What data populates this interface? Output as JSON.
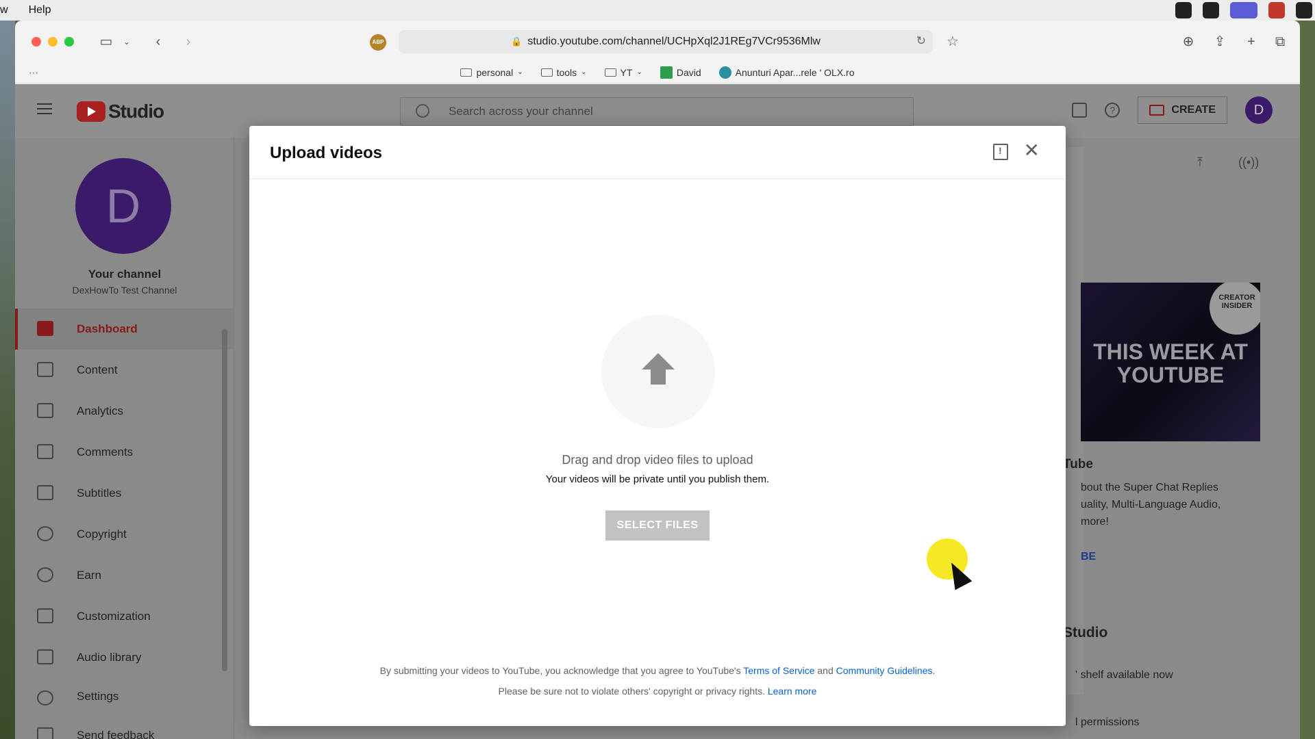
{
  "menubar": {
    "items": [
      "w",
      "Help"
    ]
  },
  "browser": {
    "url": "studio.youtube.com/channel/UCHpXql2J1REg7VCr9536Mlw",
    "abp_label": "ABP",
    "bookmarks": [
      {
        "label": "personal",
        "type": "folder"
      },
      {
        "label": "tools",
        "type": "folder"
      },
      {
        "label": "YT",
        "type": "folder"
      },
      {
        "label": "David",
        "type": "sheet"
      },
      {
        "label": "Anunturi Apar...rele ' OLX.ro",
        "type": "olx"
      }
    ]
  },
  "studio": {
    "logo_text": "Studio",
    "search_placeholder": "Search across your channel",
    "create_label": "CREATE",
    "avatar_letter": "D",
    "channel": {
      "your_channel": "Your channel",
      "name": "DexHowTo Test Channel"
    },
    "nav": [
      {
        "label": "Dashboard",
        "active": true
      },
      {
        "label": "Content"
      },
      {
        "label": "Analytics"
      },
      {
        "label": "Comments"
      },
      {
        "label": "Subtitles"
      },
      {
        "label": "Copyright"
      },
      {
        "label": "Earn"
      },
      {
        "label": "Customization"
      },
      {
        "label": "Audio library"
      },
      {
        "label": "Settings"
      },
      {
        "label": "Send feedback"
      }
    ],
    "background": {
      "thumb_title": "THIS WEEK AT YOUTUBE",
      "insider": "CREATOR INSIDER",
      "card_title": "Tube",
      "card_text_1": "bout the Super Chat Replies",
      "card_text_2": "uality, Multi-Language Audio,",
      "card_text_3": "more!",
      "card_link": "BE",
      "studio_heading": "Studio",
      "shelf_text": "' shelf available now",
      "perm_text": "l permissions"
    }
  },
  "modal": {
    "title": "Upload videos",
    "drag_text": "Drag and drop video files to upload",
    "private_text": "Your videos will be private until you publish them.",
    "select_button": "SELECT FILES",
    "legal_prefix": "By submitting your videos to YouTube, you acknowledge that you agree to YouTube's ",
    "terms_link": "Terms of Service",
    "legal_and": " and ",
    "guidelines_link": "Community Guidelines",
    "legal_suffix": ".",
    "legal2_text": "Please be sure not to violate others' copyright or privacy rights. ",
    "learn_more": "Learn more"
  }
}
